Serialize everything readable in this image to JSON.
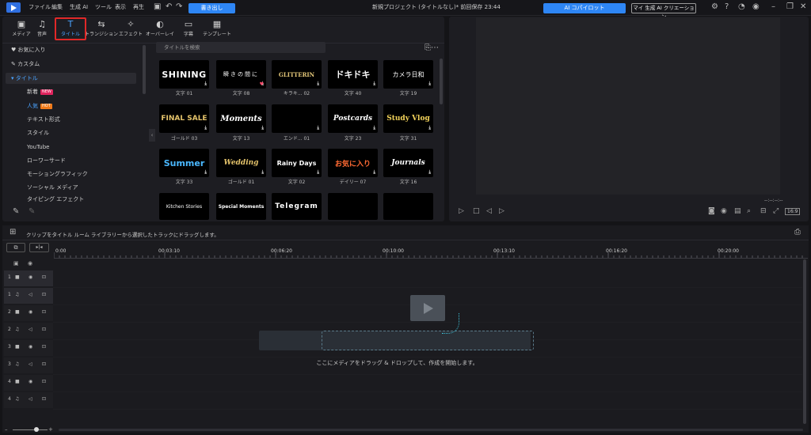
{
  "menubar": {
    "items": [
      "ファイル",
      "編集",
      "生成 AI",
      "ツール",
      "表示",
      "再生"
    ],
    "export_label": "書き出し",
    "project_title": "新規プロジェクト (タイトルなし)* 前回保存 23:44",
    "ai_copilot": "AI コパイロット",
    "ai_creation": "マイ 生成 AI クリエーション"
  },
  "tabs": [
    {
      "label": "メディア",
      "icon": "▣"
    },
    {
      "label": "音声",
      "icon": "♫"
    },
    {
      "label": "タイトル",
      "icon": "T"
    },
    {
      "label": "トランジション",
      "icon": "⇆"
    },
    {
      "label": "エフェクト",
      "icon": "✧"
    },
    {
      "label": "オーバーレイ",
      "icon": "◐"
    },
    {
      "label": "字幕",
      "icon": "▭"
    },
    {
      "label": "テンプレート",
      "icon": "▦"
    }
  ],
  "sidebar": {
    "favorites": "お気に入り",
    "custom": "カスタム",
    "title": "タイトル",
    "items": [
      "新着",
      "人気",
      "テキスト形式",
      "スタイル",
      "YouTube",
      "ローワーサード",
      "モーショングラフィック",
      "ソーシャル メディア",
      "タイピング エフェクト"
    ],
    "badge_new": "NEW",
    "badge_hot": "HOT"
  },
  "search": {
    "placeholder": "タイトルを検索"
  },
  "cards": [
    {
      "text": "SHINING",
      "label": "文字 01"
    },
    {
      "text": "瞬きの間に",
      "label": "文字 08"
    },
    {
      "text": "GLITTERIN",
      "label": "キラキ... 02"
    },
    {
      "text": "ドキドキ",
      "label": "文字 40"
    },
    {
      "text": "カメラ日和",
      "label": "文字 19"
    },
    {
      "text": "FINAL SALE",
      "label": "ゴールド 03"
    },
    {
      "text": "Moments",
      "label": "文字 13"
    },
    {
      "text": "",
      "label": "エンド... 01"
    },
    {
      "text": "Postcards",
      "label": "文字 23"
    },
    {
      "text": "Study Vlog",
      "label": "文字 31"
    },
    {
      "text": "Summer",
      "label": "文字 33"
    },
    {
      "text": "Wedding",
      "label": "ゴールド 01"
    },
    {
      "text": "Rainy Days",
      "label": "文字 02"
    },
    {
      "text": "お気に入り",
      "label": "デイリー 07"
    },
    {
      "text": "Journals",
      "label": "文字 16"
    },
    {
      "text": "Kitchen Stories",
      "label": ""
    },
    {
      "text": "Special Moments",
      "label": ""
    },
    {
      "text": "Telegram",
      "label": ""
    },
    {
      "text": "",
      "label": ""
    },
    {
      "text": "",
      "label": ""
    }
  ],
  "preview": {
    "timecode": "--:--:--:--",
    "aspect": "16:9"
  },
  "timeline": {
    "hint": "クリップをタイトル ルーム ライブラリーから選択したトラックにドラッグします。",
    "ruler": [
      "0:00",
      "00:03:10",
      "00:06:20",
      "00:10:00",
      "00:13:10",
      "00:16:20",
      "00:20:00"
    ],
    "drop_hint": "ここにメディアをドラッグ & ドロップして、作成を開始します。",
    "tracks": [
      "1",
      "1",
      "2",
      "2",
      "3",
      "3",
      "4",
      "4"
    ]
  },
  "colors": {
    "accent": "#2e86f5",
    "highlight": "#e02828",
    "badge_new": "#e0245e",
    "badge_hot": "#f07a1a"
  }
}
